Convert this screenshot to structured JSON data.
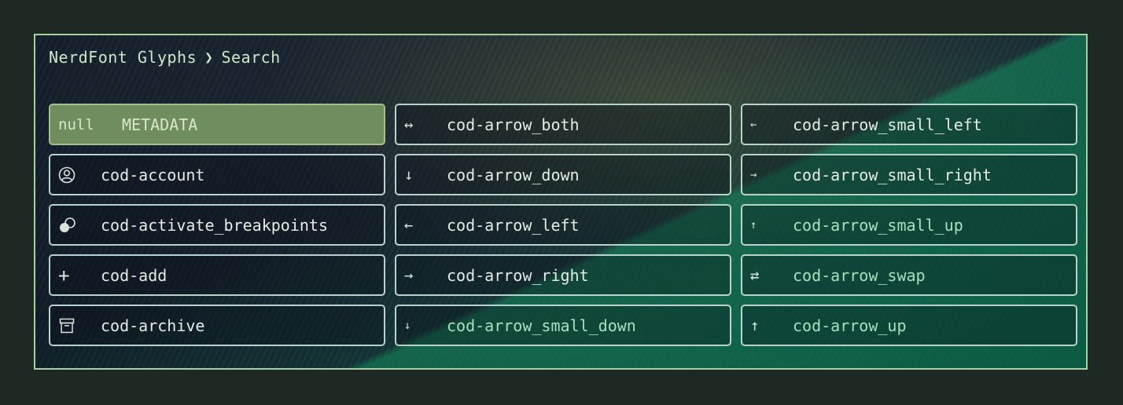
{
  "breadcrumb": {
    "root": "NerdFont Glyphs",
    "separator": "❯",
    "current": "Search"
  },
  "glyphs": [
    {
      "icon": "null",
      "label": "METADATA",
      "selected": true
    },
    {
      "icon": "arrow-both-icon",
      "glyph": "↔",
      "label": "cod-arrow_both"
    },
    {
      "icon": "arrow-small-left-icon",
      "glyph": "←",
      "label": "cod-arrow_small_left"
    },
    {
      "icon": "account-icon",
      "label": "cod-account"
    },
    {
      "icon": "arrow-down-icon",
      "glyph": "↓",
      "label": "cod-arrow_down"
    },
    {
      "icon": "arrow-small-right-icon",
      "glyph": "→",
      "label": "cod-arrow_small_right"
    },
    {
      "icon": "activate-breakpoints-icon",
      "label": "cod-activate_breakpoints"
    },
    {
      "icon": "arrow-left-icon",
      "glyph": "←",
      "label": "cod-arrow_left"
    },
    {
      "icon": "arrow-small-up-icon",
      "glyph": "↑",
      "label": "cod-arrow_small_up"
    },
    {
      "icon": "add-icon",
      "glyph": "+",
      "label": "cod-add"
    },
    {
      "icon": "arrow-right-icon",
      "glyph": "→",
      "label": "cod-arrow_right"
    },
    {
      "icon": "arrow-swap-icon",
      "glyph": "⇄",
      "label": "cod-arrow_swap"
    },
    {
      "icon": "archive-icon",
      "label": "cod-archive"
    },
    {
      "icon": "arrow-small-down-icon",
      "glyph": "↓",
      "label": "cod-arrow_small_down"
    },
    {
      "icon": "arrow-up-icon",
      "glyph": "↑",
      "label": "cod-arrow_up"
    }
  ],
  "colors": {
    "selected_bg": "#6f8d5e",
    "border": "#b7d3cc",
    "frame_border": "#a8cfa0"
  }
}
